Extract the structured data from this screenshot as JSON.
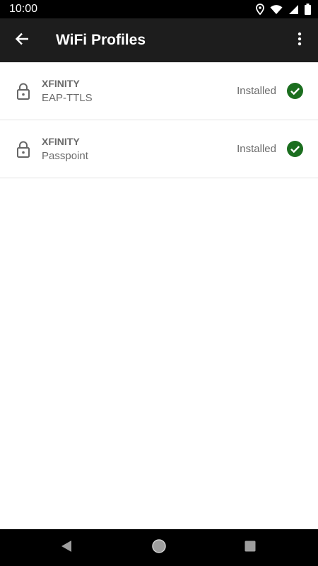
{
  "status_bar": {
    "time": "10:00",
    "icons": [
      "location-icon",
      "wifi-icon",
      "signal-icon",
      "battery-icon"
    ]
  },
  "app_bar": {
    "title": "WiFi Profiles",
    "back_icon": "arrow-back-icon",
    "menu_icon": "more-vertical-icon"
  },
  "profiles": [
    {
      "name": "XFINITY",
      "type": "EAP-TTLS",
      "status": "Installed"
    },
    {
      "name": "XFINITY",
      "type": "Passpoint",
      "status": "Installed"
    }
  ],
  "nav_bar": {
    "icons": [
      "nav-back-icon",
      "nav-home-icon",
      "nav-recents-icon"
    ]
  },
  "colors": {
    "status_bar": "#000000",
    "app_bar": "#1d1d1d",
    "installed_check": "#1b6e1f",
    "text_secondary": "#6b6b6b",
    "divider": "#e4e4e4"
  }
}
